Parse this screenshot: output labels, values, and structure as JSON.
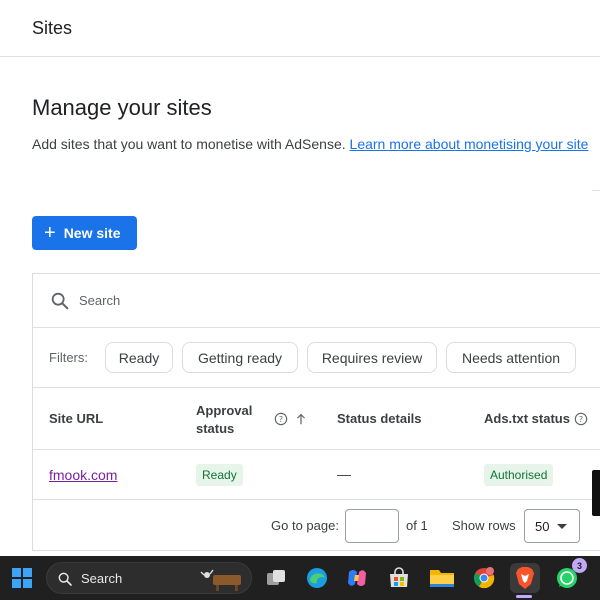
{
  "topbar": {
    "title": "Sites"
  },
  "page": {
    "heading": "Manage your sites",
    "subtext": "Add sites that you want to monetise with AdSense.",
    "learn_more": "Learn more about monetising your site"
  },
  "actions": {
    "new_site_label": "New site"
  },
  "search": {
    "placeholder": "Search"
  },
  "filters": {
    "label": "Filters:",
    "chips": [
      "Ready",
      "Getting ready",
      "Requires review",
      "Needs attention"
    ]
  },
  "table": {
    "headers": {
      "site_url": "Site URL",
      "approval_status_line1": "Approval",
      "approval_status_line2": "status",
      "status_details": "Status details",
      "ads_txt_status": "Ads.txt status"
    },
    "rows": [
      {
        "site_url": "fmook.com",
        "approval_status": "Ready",
        "status_details": "—",
        "ads_txt_status": "Authorised"
      }
    ]
  },
  "pagination": {
    "go_to_page": "Go to page:",
    "page_value": "",
    "of_pages": "of 1",
    "show_rows": "Show rows",
    "rows_value": "50"
  },
  "taskbar": {
    "search_label": "Search",
    "whatsapp_badge": "3",
    "icons": [
      "windows-start-icon",
      "search-icon",
      "widget-icon",
      "task-view-icon",
      "edge-icon",
      "copilot-icon",
      "store-icon",
      "file-explorer-icon",
      "chrome-icon",
      "brave-icon",
      "whatsapp-icon"
    ]
  },
  "colors": {
    "accent": "#1a73e8",
    "link": "#1a73e8",
    "visited_link": "#7b1fa2",
    "ready_bg": "#e6f4ea",
    "ready_text": "#137333",
    "taskbar_bg": "#202020"
  }
}
